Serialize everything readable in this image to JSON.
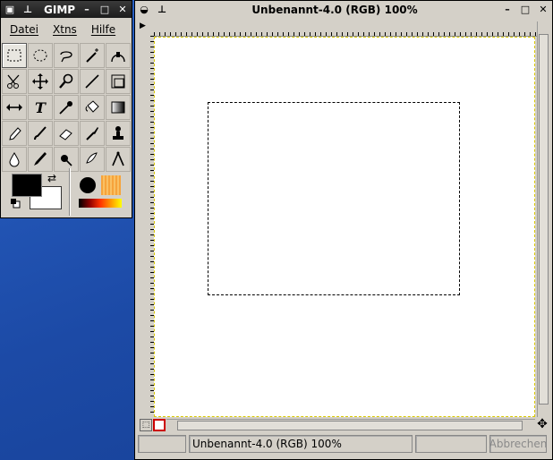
{
  "toolbox": {
    "title": "GIMP",
    "menu": [
      "Datei",
      "Xtns",
      "Hilfe"
    ],
    "tools": [
      "rect-select-icon",
      "ellipse-select-icon",
      "lasso-icon",
      "magic-wand-icon",
      "bezier-path-icon",
      "scissors-icon",
      "move-icon",
      "magnify-icon",
      "crop-icon",
      "transform-icon",
      "flip-icon",
      "text-icon",
      "color-picker-icon",
      "bucket-fill-icon",
      "blend-icon",
      "pencil-icon",
      "paintbrush-icon",
      "eraser-icon",
      "airbrush-icon",
      "clone-icon",
      "convolve-icon",
      "ink-icon",
      "dodge-burn-icon",
      "smudge-icon",
      "measure-icon"
    ],
    "fg_color": "#000000",
    "bg_color": "#ffffff"
  },
  "image_window": {
    "title": "Unbenannt-4.0 (RGB) 100%",
    "status": "Unbenannt-4.0 (RGB) 100%",
    "cancel_label": "Abbrechen"
  }
}
